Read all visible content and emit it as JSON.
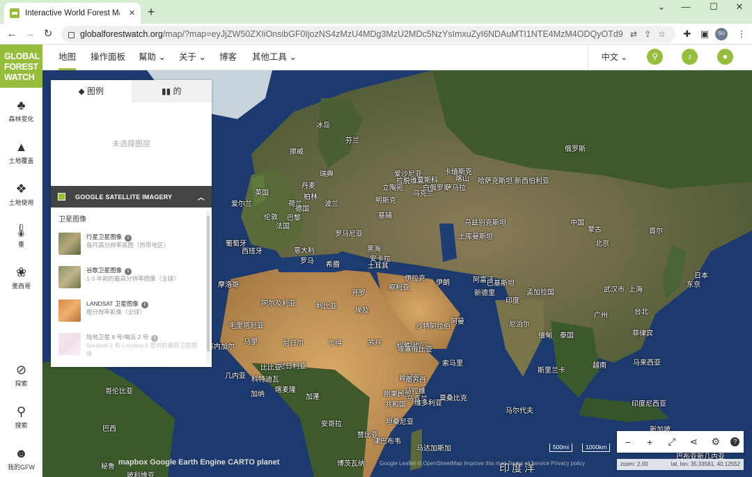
{
  "browser": {
    "tab_title": "Interactive World Forest Map",
    "url_host": "globalforestwatch.org",
    "url_rest": "/map/?map=eyJjZW50ZXIiOnsibGF0IjozNS4zMzU4MDg3MzU2MDc5NzYsImxuZyI6NDAuMTI1NTE4MzM4ODQyOTd9LCJ6...",
    "profile_initials": "SU"
  },
  "gfw": {
    "logo_lines": [
      "GLOBAL",
      "FOREST",
      "WATCH"
    ],
    "nav": [
      "地图",
      "操作面板",
      "幫助 ⌄",
      "关于 ⌄",
      "博客",
      "其他工具 ⌄"
    ],
    "language": "中文 ⌄"
  },
  "sidebar": {
    "top": [
      {
        "label": "森林变化",
        "icon": "tree-icon"
      },
      {
        "label": "土地覆盖",
        "icon": "land-cover-icon"
      },
      {
        "label": "土地使用",
        "icon": "land-use-icon"
      },
      {
        "label": "垂",
        "icon": "thermometer-icon"
      },
      {
        "label": "墨西哥",
        "icon": "paw-icon"
      }
    ],
    "bottom": [
      {
        "label": "探索",
        "icon": "compass-icon"
      },
      {
        "label": "搜索",
        "icon": "search-icon"
      },
      {
        "label": "我的GFW",
        "icon": "user-icon"
      }
    ]
  },
  "legend": {
    "tab_legend": "图例",
    "tab_analysis": "的",
    "empty_text": "未选择图层",
    "basemap_title": "GOOGLE SATELLITE IMAGERY",
    "section_label": "卫星图像",
    "options": [
      {
        "title": "行星卫星图像",
        "desc": "每月高分辨率底图（热带地区）"
      },
      {
        "title": "谷歌卫星图像",
        "desc": "1-3 年前的最高分辨率图像（全球）"
      },
      {
        "title": "LANDSAT 卫星图像",
        "desc": "粗分辨率影像（全球）"
      },
      {
        "title": "陆地卫星 8 号/哨兵 2 号",
        "desc": "Sentinel-2 和 Landsat 8 提供的最新卫星图像"
      }
    ]
  },
  "map": {
    "labels": [
      {
        "t": "冰岛"
      },
      {
        "t": "瑞典"
      },
      {
        "t": "芬兰"
      },
      {
        "t": "挪威"
      },
      {
        "t": "俄罗斯"
      },
      {
        "t": "爱沙尼亚"
      },
      {
        "t": "拉脱维亚"
      },
      {
        "t": "立陶宛"
      },
      {
        "t": "白俄罗斯"
      },
      {
        "t": "乌克兰"
      },
      {
        "t": "英国"
      },
      {
        "t": "爱尔兰"
      },
      {
        "t": "丹麦"
      },
      {
        "t": "荷兰"
      },
      {
        "t": "柏林"
      },
      {
        "t": "德国"
      },
      {
        "t": "波兰"
      },
      {
        "t": "法国"
      },
      {
        "t": "巴黎"
      },
      {
        "t": "伦敦"
      },
      {
        "t": "罗马尼亚"
      },
      {
        "t": "基辅"
      },
      {
        "t": "明斯克"
      },
      {
        "t": "莫斯科"
      },
      {
        "t": "喀山"
      },
      {
        "t": "卡缅斯克"
      },
      {
        "t": "萨马拉"
      },
      {
        "t": "新西伯利亚"
      },
      {
        "t": "哈萨克斯坦"
      },
      {
        "t": "蒙古"
      },
      {
        "t": "西班牙"
      },
      {
        "t": "葡萄牙"
      },
      {
        "t": "意大利"
      },
      {
        "t": "罗马"
      },
      {
        "t": "希腊"
      },
      {
        "t": "土耳其"
      },
      {
        "t": "安卡拉"
      },
      {
        "t": "黑海"
      },
      {
        "t": "乌兹别克斯坦"
      },
      {
        "t": "土库曼斯坦"
      },
      {
        "t": "伊朗"
      },
      {
        "t": "伊拉克"
      },
      {
        "t": "叙利亚"
      },
      {
        "t": "阿富汗"
      },
      {
        "t": "巴基斯坦"
      },
      {
        "t": "摩洛哥"
      },
      {
        "t": "阿尔及利亚"
      },
      {
        "t": "利比亚"
      },
      {
        "t": "埃及"
      },
      {
        "t": "开罗"
      },
      {
        "t": "沙特阿拉伯"
      },
      {
        "t": "利雅得"
      },
      {
        "t": "阿曼"
      },
      {
        "t": "也门"
      },
      {
        "t": "新德里"
      },
      {
        "t": "印度"
      },
      {
        "t": "尼泊尔"
      },
      {
        "t": "孟加拉国"
      },
      {
        "t": "缅甸"
      },
      {
        "t": "泰国"
      },
      {
        "t": "中国"
      },
      {
        "t": "北京"
      },
      {
        "t": "首尔"
      },
      {
        "t": "日本"
      },
      {
        "t": "东京"
      },
      {
        "t": "上海"
      },
      {
        "t": "武汉市"
      },
      {
        "t": "广州"
      },
      {
        "t": "台北"
      },
      {
        "t": "越南"
      },
      {
        "t": "菲律宾"
      },
      {
        "t": "马来西亚"
      },
      {
        "t": "印度尼西亚"
      },
      {
        "t": "新加坡"
      },
      {
        "t": "巴布亚新几内亚"
      },
      {
        "t": "马里"
      },
      {
        "t": "尼日尔"
      },
      {
        "t": "乍得"
      },
      {
        "t": "苏丹"
      },
      {
        "t": "尼日利亚"
      },
      {
        "t": "埃塞俄比亚"
      },
      {
        "t": "肯尼亚"
      },
      {
        "t": "索马里"
      },
      {
        "t": "刚果民主"
      },
      {
        "t": "共和国"
      },
      {
        "t": "坦桑尼亚"
      },
      {
        "t": "安哥拉"
      },
      {
        "t": "赞比亚"
      },
      {
        "t": "津巴布韦"
      },
      {
        "t": "博茨瓦纳"
      },
      {
        "t": "马达加斯加"
      },
      {
        "t": "乌克兰"
      },
      {
        "t": "巴西"
      },
      {
        "t": "秘鲁"
      },
      {
        "t": "玻利维亚"
      },
      {
        "t": "委内瑞拉"
      },
      {
        "t": "哥伦比亚"
      },
      {
        "t": "加纳"
      },
      {
        "t": "喀麦隆"
      },
      {
        "t": "加蓬"
      },
      {
        "t": "毛里塔尼亚"
      },
      {
        "t": "塞内加尔"
      },
      {
        "t": "比比亚"
      },
      {
        "t": "几内亚"
      },
      {
        "t": "科特迪瓦"
      },
      {
        "t": "维多利亚"
      },
      {
        "t": "南苏丹"
      },
      {
        "t": "马拉维"
      },
      {
        "t": "莫桑比克"
      },
      {
        "t": "斯里兰卡"
      },
      {
        "t": "马尔代夫"
      },
      {
        "t": "印度洋"
      }
    ],
    "scale": [
      "500mi",
      "1000km"
    ],
    "zoom": "zoom: 2.00",
    "latlon": "lat, lon: 35.33581, 40.12552",
    "attribution_logos": "mapbox   Google Earth Engine   CARTO   planet",
    "attribution_text": "Google  Leaflet  © OpenStreetMap   Improve this map   Terms of Service   Privacy policy"
  },
  "colors": {
    "brand": "#97bd3d",
    "ocean": "#1d3a6e",
    "desert": "#c9975a",
    "forest": "#3f5a2a"
  }
}
